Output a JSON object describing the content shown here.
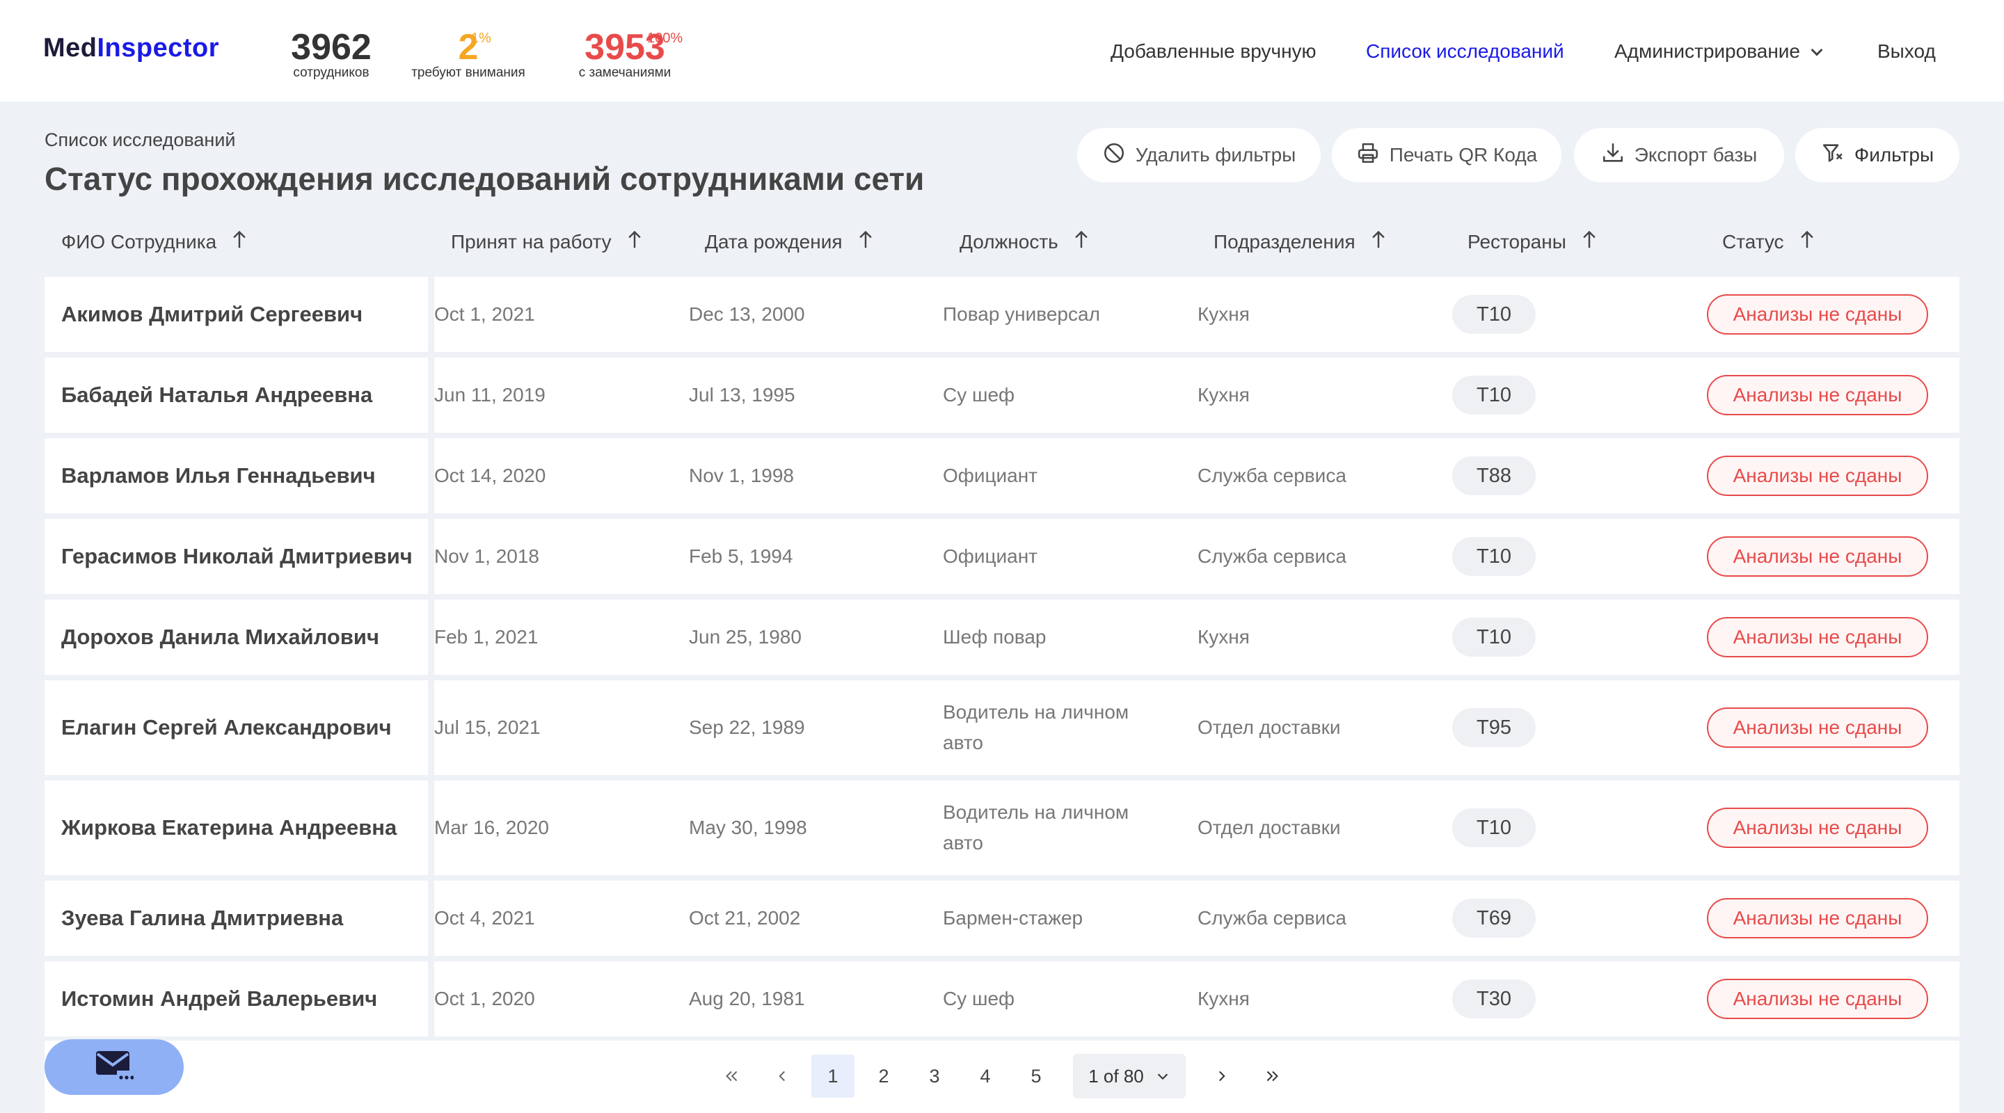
{
  "app": {
    "logo_prefix": "Med",
    "logo_accent": "Inspector"
  },
  "stats": [
    {
      "value": "3962",
      "sup": "",
      "caption": "сотрудников",
      "color": "#333333"
    },
    {
      "value": "2",
      "sup": "1%",
      "caption": "требуют внимания",
      "color": "#f5a623"
    },
    {
      "value": "3953",
      "sup": "100%",
      "caption": "с замечаниями",
      "color": "#e84a4a"
    }
  ],
  "nav": {
    "manual": "Добавленные вручную",
    "studies": "Список исследований",
    "admin": "Администрирование",
    "logout": "Выход"
  },
  "page": {
    "breadcrumb": "Список исследований",
    "title": "Статус прохождения исследований сотрудниками сети"
  },
  "actions": {
    "clear_filters": "Удалить фильтры",
    "print_qr": "Печать QR Кода",
    "export": "Экспорт базы",
    "filters": "Фильтры"
  },
  "table": {
    "columns": [
      "ФИО Сотрудника",
      "Принят на работу",
      "Дата рождения",
      "Должность",
      "Подразделения",
      "Рестораны",
      "Статус"
    ],
    "rows": [
      {
        "name": "Акимов Дмитрий Сергеевич",
        "hired": "Oct 1, 2021",
        "birth": "Dec 13, 2000",
        "position": "Повар универсал",
        "dept": "Кухня",
        "restaurant": "T10",
        "status": "Анализы не сданы"
      },
      {
        "name": "Бабадей Наталья Андреевна",
        "hired": "Jun 11, 2019",
        "birth": "Jul 13, 1995",
        "position": "Су шеф",
        "dept": "Кухня",
        "restaurant": "T10",
        "status": "Анализы не сданы"
      },
      {
        "name": "Варламов Илья Геннадьевич",
        "hired": "Oct 14, 2020",
        "birth": "Nov 1, 1998",
        "position": "Официант",
        "dept": "Служба сервиса",
        "restaurant": "T88",
        "status": "Анализы не сданы"
      },
      {
        "name": "Герасимов Николай Дмитриевич",
        "hired": "Nov 1, 2018",
        "birth": "Feb 5, 1994",
        "position": "Официант",
        "dept": "Служба сервиса",
        "restaurant": "T10",
        "status": "Анализы не сданы"
      },
      {
        "name": "Дорохов Данила Михайлович",
        "hired": "Feb 1, 2021",
        "birth": "Jun 25, 1980",
        "position": "Шеф повар",
        "dept": "Кухня",
        "restaurant": "T10",
        "status": "Анализы не сданы"
      },
      {
        "name": "Елагин Сергей Александрович",
        "hired": "Jul 15, 2021",
        "birth": "Sep 22, 1989",
        "position": "Водитель на личном авто",
        "dept": "Отдел доставки",
        "restaurant": "T95",
        "status": "Анализы не сданы"
      },
      {
        "name": "Жиркова Екатерина Андреевна",
        "hired": "Mar 16, 2020",
        "birth": "May 30, 1998",
        "position": "Водитель на личном авто",
        "dept": "Отдел доставки",
        "restaurant": "T10",
        "status": "Анализы не сданы"
      },
      {
        "name": "Зуева Галина Дмитриевна",
        "hired": "Oct 4, 2021",
        "birth": "Oct 21, 2002",
        "position": "Бармен-стажер",
        "dept": "Служба сервиса",
        "restaurant": "T69",
        "status": "Анализы не сданы"
      },
      {
        "name": "Истомин Андрей Валерьевич",
        "hired": "Oct 1, 2020",
        "birth": "Aug 20, 1981",
        "position": "Су шеф",
        "dept": "Кухня",
        "restaurant": "T30",
        "status": "Анализы не сданы"
      }
    ]
  },
  "pagination": {
    "pages": [
      "1",
      "2",
      "3",
      "4",
      "5"
    ],
    "current": "1",
    "select_label": "1 of 80"
  },
  "icons": {
    "chat": "mail-chat-icon",
    "clear": "ban-icon",
    "print": "printer-icon",
    "export": "download-icon",
    "filter": "filter-icon"
  },
  "colors": {
    "accent": "#1a1ae6",
    "warning": "#f5a623",
    "danger": "#e84a4a",
    "chat_button": "#8fb0f5"
  }
}
